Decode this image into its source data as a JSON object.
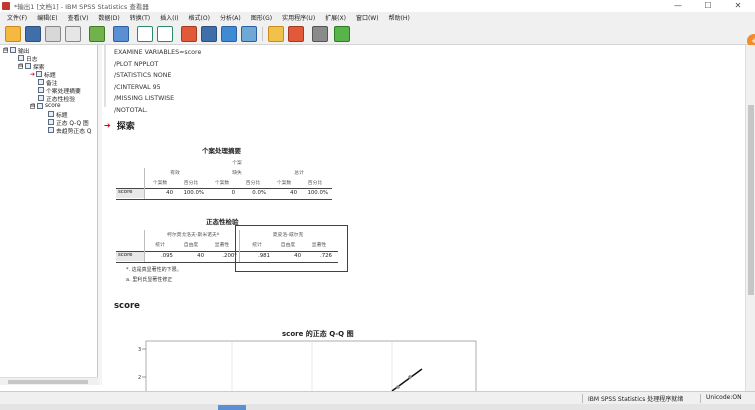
{
  "window": {
    "title": "*输出1 [文档1] - IBM SPSS Statistics 查看器",
    "min": "—",
    "max": "☐",
    "close": "✕"
  },
  "menu": [
    "文件(F)",
    "编辑(E)",
    "查看(V)",
    "数据(D)",
    "转换(T)",
    "插入(I)",
    "格式(O)",
    "分析(A)",
    "图形(G)",
    "实用程序(U)",
    "扩展(X)",
    "窗口(W)",
    "帮助(H)"
  ],
  "outline": {
    "items": [
      {
        "label": "输出",
        "expander": "⊟"
      },
      {
        "label": "日志"
      },
      {
        "label": "探索",
        "expander": "⊟"
      },
      {
        "label": "标题"
      },
      {
        "label": "备注"
      },
      {
        "label": "个案处理摘要"
      },
      {
        "label": "正态性检验"
      },
      {
        "label": "score",
        "expander": "⊟"
      },
      {
        "label": "标题"
      },
      {
        "label": "正态 Q-Q 图"
      },
      {
        "label": "去趋势正态 Q"
      }
    ]
  },
  "syntax": [
    "EXAMINE VARIABLES=score",
    "  /PLOT NPPLOT",
    "  /STATISTICS NONE",
    "  /CINTERVAL 95",
    "  /MISSING LISTWISE",
    "  /NOTOTAL."
  ],
  "section_title": "探索",
  "case_summary": {
    "title": "个案处理摘要",
    "group_header": "个案",
    "groups": [
      "有效",
      "缺失",
      "总计"
    ],
    "sub_headers": [
      "个案数",
      "百分比",
      "个案数",
      "百分比",
      "个案数",
      "百分比"
    ],
    "row_label": "score",
    "values": [
      "40",
      "100.0%",
      "0",
      "0.0%",
      "40",
      "100.0%"
    ]
  },
  "normality": {
    "title": "正态性检验",
    "groups": [
      "柯尔莫戈洛夫-斯米诺夫ª",
      "夏皮洛-威尔克"
    ],
    "sub_headers": [
      "统计",
      "自由度",
      "显著性",
      "统计",
      "自由度",
      "显著性"
    ],
    "row_label": "score",
    "values": [
      ".095",
      "40",
      ".200*",
      ".981",
      "40",
      ".726"
    ],
    "notes": [
      "*. 这是真显著性的下限。",
      "a. 里利氏显著性修正"
    ]
  },
  "score_heading": "score",
  "qq_title": "score 的正态 Q-Q 图",
  "qq_axis": [
    "3",
    "2"
  ],
  "status": {
    "processor": "IBM SPSS Statistics 处理程序就绪",
    "unicode": "Unicode:ON"
  }
}
